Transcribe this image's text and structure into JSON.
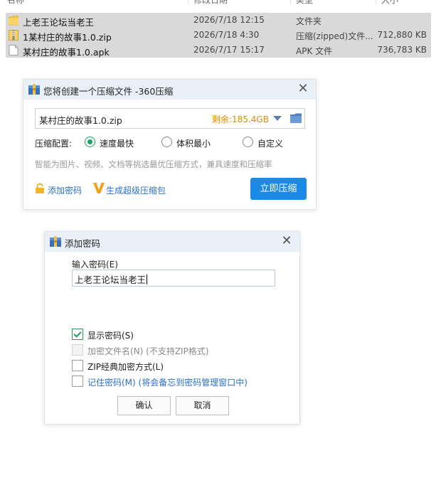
{
  "explorer": {
    "headers": {
      "name": "名称",
      "date": "修改日期",
      "type": "类型",
      "size": "大小"
    },
    "files": [
      {
        "icon": "folder-icon",
        "name": "上老王论坛当老王",
        "date": "2026/7/18 12:15",
        "type": "文件夹",
        "size": ""
      },
      {
        "icon": "zip-file-icon",
        "name": "1某村庄的故事1.0.zip",
        "date": "2026/7/18 4:30",
        "type": "压缩(zipped)文件...",
        "size": "712,880 KB"
      },
      {
        "icon": "apk-file-icon",
        "name": "某村庄的故事1.0.apk",
        "date": "2026/7/17 15:17",
        "type": "APK 文件",
        "size": "736,783 KB"
      }
    ]
  },
  "compress_dialog": {
    "title": "您将创建一个压缩文件 -360压缩",
    "path": "某村庄的故事1.0.zip",
    "free_space": "剩余:185.4GB",
    "config_label": "压缩配置:",
    "options": [
      "速度最快",
      "体积最小",
      "自定义"
    ],
    "selected_option": "速度最快",
    "hint": "智能为图片、视频、文档等挑选最优压缩方式，兼具速度和压缩率",
    "add_password": "添加密码",
    "super_package": "生成超级压缩包",
    "compress_now": "立即压缩"
  },
  "password_dialog": {
    "title": "添加密码",
    "input_label": "输入密码(E)",
    "password_value": "上老王论坛当老王",
    "show_password": "显示密码(S)",
    "encrypt_filenames": "加密文件名(N) (不支持ZIP格式)",
    "zip_classic": "ZIP经典加密方式(L)",
    "remember_password": "记住密码(M) (将会备忘到密码管理窗口中)",
    "ok": "确认",
    "cancel": "取消"
  },
  "colors": {
    "accent": "#1a8ae6",
    "free_space": "#e08a00",
    "radio_checked": "#1aa260",
    "link": "#2a72c6",
    "titlebar": "#eaf0f8"
  }
}
